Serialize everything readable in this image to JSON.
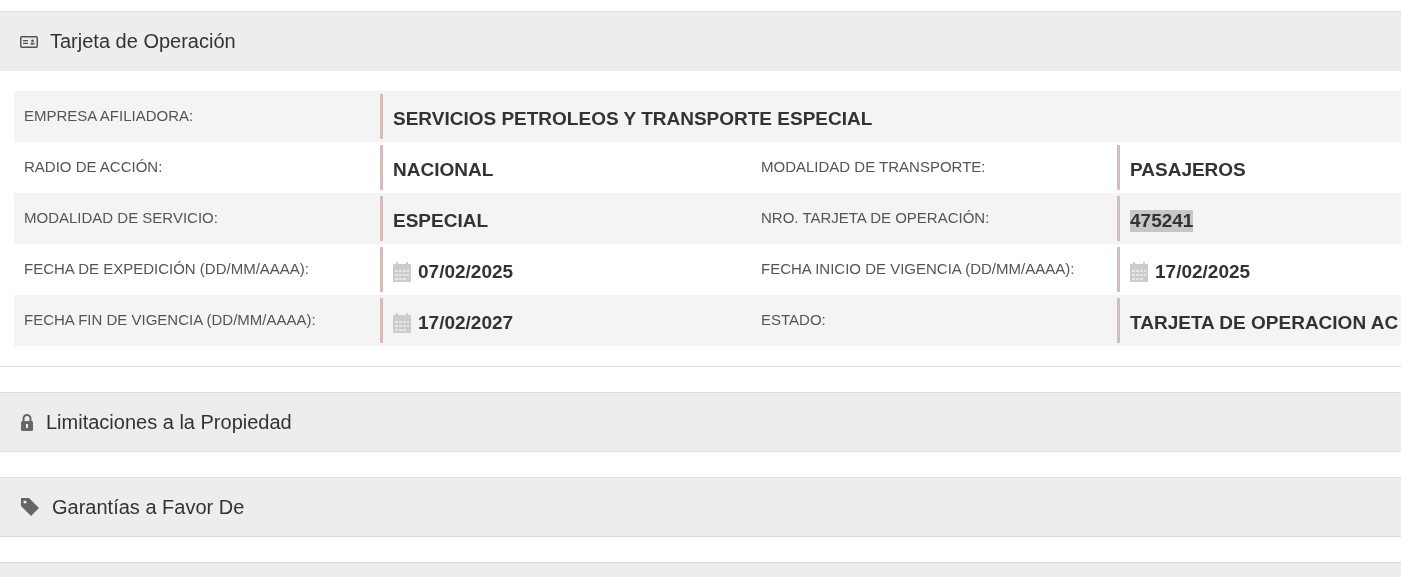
{
  "sections": [
    {
      "title": "Tarjeta de Operación",
      "expanded": true,
      "rows": [
        {
          "cells": [
            {
              "label": "EMPRESA AFILIADORA:",
              "value": "SERVICIOS PETROLEOS Y TRANSPORTE ESPECIAL",
              "kind": "text",
              "highlighted": false
            }
          ]
        },
        {
          "cells": [
            {
              "label": "RADIO DE ACCIÓN:",
              "value": "NACIONAL",
              "kind": "text",
              "highlighted": false
            },
            {
              "label": "MODALIDAD DE TRANSPORTE:",
              "value": "PASAJEROS",
              "kind": "text",
              "highlighted": false
            }
          ]
        },
        {
          "cells": [
            {
              "label": "MODALIDAD DE SERVICIO:",
              "value": "ESPECIAL",
              "kind": "text",
              "highlighted": false
            },
            {
              "label": "NRO. TARJETA DE OPERACIÓN:",
              "value": "475241",
              "kind": "text",
              "highlighted": true
            }
          ]
        },
        {
          "cells": [
            {
              "label": "FECHA DE EXPEDICIÓN (DD/MM/AAAA):",
              "value": "07/02/2025",
              "kind": "date",
              "highlighted": false
            },
            {
              "label": "FECHA INICIO DE VIGENCIA (DD/MM/AAAA):",
              "value": "17/02/2025",
              "kind": "date",
              "highlighted": false
            }
          ]
        },
        {
          "cells": [
            {
              "label": "FECHA FIN DE VIGENCIA (DD/MM/AAAA):",
              "value": "17/02/2027",
              "kind": "date",
              "highlighted": false
            },
            {
              "label": "ESTADO:",
              "value": "TARJETA DE OPERACION AC",
              "kind": "text",
              "highlighted": false
            }
          ]
        }
      ]
    },
    {
      "title": "Limitaciones a la Propiedad",
      "expanded": false
    },
    {
      "title": "Garantías a Favor De",
      "expanded": false
    },
    {
      "expanded": false
    }
  ]
}
